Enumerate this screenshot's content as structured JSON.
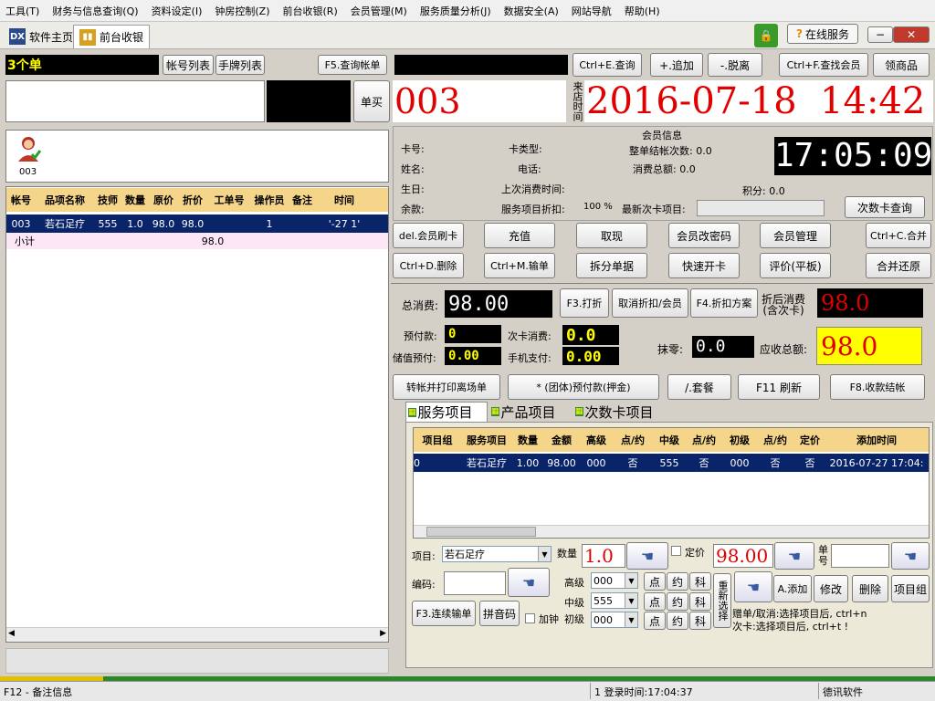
{
  "menu": [
    "工具(T)",
    "财务与信息查询(Q)",
    "资料设定(I)",
    "钟房控制(Z)",
    "前台收银(R)",
    "会员管理(M)",
    "服务质量分析(J)",
    "数据安全(A)",
    "网站导航",
    "帮助(H)"
  ],
  "tabs": {
    "home": "软件主页",
    "front": "前台收银",
    "home_icon": "DX"
  },
  "online_service": "在线服务",
  "left": {
    "order_count": "3个单",
    "account_list": "帐号列表",
    "tag_list": "手牌列表",
    "query_bill": "F5.查询帐单",
    "single_buy": "单买",
    "room_label": "003",
    "columns": [
      "帐号",
      "品项名称",
      "技师",
      "数量",
      "原价",
      "折价",
      "工单号",
      "操作员",
      "备注",
      "时间"
    ],
    "row": [
      "003",
      "若石足疗",
      "555",
      "1.0",
      "98.0",
      "98.0",
      "",
      "1",
      "",
      "'-27 1'"
    ],
    "subtotal_label": "小计",
    "subtotal_value": "98.0"
  },
  "top": {
    "query": "Ctrl+E.查询",
    "add": "+.追加",
    "leave": "-.脱离",
    "find_member": "Ctrl+F.查找会员",
    "pickup": "领商品",
    "room_no": "003",
    "arrive_label": "来店时间",
    "arrive_time": "2016-07-18  14:42",
    "clock": "17:05:09"
  },
  "member": {
    "title": "会员信息",
    "card_no": "卡号:",
    "card_type": "卡类型:",
    "settle_count": "整单结帐次数: 0.0",
    "name": "姓名:",
    "phone": "电话:",
    "spend_total": "消费总额: 0.0",
    "birthday": "生日:",
    "last_spend": "上次消费时间:",
    "points": "积分: 0.0",
    "balance": "余款:",
    "service_discount": "服务项目折扣:",
    "discount_value": "100 %",
    "latest_card": "最新次卡项目:",
    "card_query": "次数卡查询"
  },
  "actions1": [
    "del.会员刷卡",
    "充值",
    "取现",
    "会员改密码",
    "会员管理",
    "Ctrl+C.合并"
  ],
  "actions2": [
    "Ctrl+D.删除",
    "Ctrl+M.输单",
    "拆分单据",
    "快速开卡",
    "评价(平板)",
    "合并还原"
  ],
  "totals": {
    "total_label": "总消费:",
    "total": "98.00",
    "discount": "F3.打折",
    "cancel_discount": "取消折扣/会员",
    "discount_plan": "F4.折扣方案",
    "after_label1": "折后消费",
    "after_label2": "(含次卡)",
    "after": "98.0",
    "prepay_label": "预付款:",
    "prepay": "0",
    "card_spend_label": "次卡消费:",
    "card_spend": "0.0",
    "stored_label": "储值预付:",
    "stored": "0.00",
    "mobile_label": "手机支付:",
    "mobile": "0.00",
    "wipe_label": "抹零:",
    "wipe": "0.0",
    "due_label": "应收总额:",
    "due": "98.0"
  },
  "actions3": [
    "转帐并打印离场单",
    "* (团体)预付款(押金)",
    "/.套餐",
    "F11 刷新",
    "F8.收款结帐"
  ],
  "itemtabs": [
    "服务项目",
    "产品项目",
    "次数卡项目"
  ],
  "grid": {
    "columns": [
      "项目组",
      "服务项目",
      "数量",
      "金额",
      "高级",
      "点/约",
      "中级",
      "点/约",
      "初级",
      "点/约",
      "定价",
      "添加时间"
    ],
    "row": [
      "0",
      "若石足疗",
      "1.00",
      "98.00",
      "000",
      "否",
      "555",
      "否",
      "000",
      "否",
      "否",
      "2016-07-27 17:04:"
    ]
  },
  "form": {
    "item_label": "项目:",
    "item_value": "若石足疗",
    "qty_label": "数量",
    "qty": "1.0",
    "fixed_label": "定价",
    "price": "98.00",
    "single_label": "单号",
    "code_label": "编码:",
    "senior_label": "高级",
    "senior": "000",
    "mid_label": "中级",
    "mid": "555",
    "junior_label": "初级",
    "junior": "000",
    "extra_label": "加钟",
    "dian": "点",
    "yue": "约",
    "ke": "科",
    "reselect": "重新选择",
    "add": "A.添加",
    "modify": "修改",
    "delete": "删除",
    "group": "项目组",
    "continuous": "F3.连续输单",
    "pinyin": "拼音码",
    "hint1": "赠单/取消:选择项目后, ctrl+n",
    "hint2": "次卡:选择项目后, ctrl+t !"
  },
  "status": {
    "f12": "F12 - 备注信息",
    "login": "1 登录时间:17:04:37",
    "company": "德讯软件"
  }
}
